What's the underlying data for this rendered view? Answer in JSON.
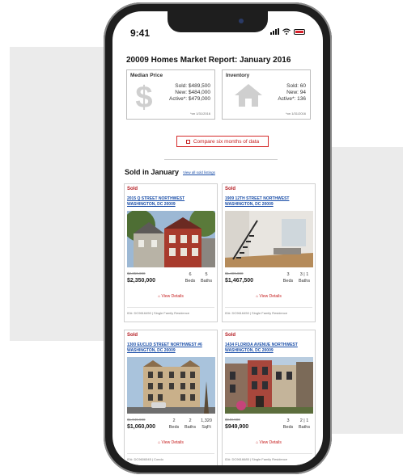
{
  "status_bar": {
    "time": "9:41"
  },
  "report": {
    "title": "20009 Homes Market Report: January 2016"
  },
  "median_price": {
    "heading": "Median Price",
    "sold": "Sold: $489,500",
    "new": "New: $484,000",
    "active": "Active*: $479,000",
    "note": "*on 1/31/2016",
    "icon": "dollar-icon"
  },
  "inventory": {
    "heading": "Inventory",
    "sold": "Sold: 60",
    "new": "New: 94",
    "active": "Active*: 136",
    "note": "*on 1/31/2016",
    "icon": "house-icon"
  },
  "compare_label": "Compare six months of data",
  "sold_section": {
    "heading": "Sold in January",
    "view_all": "View all sold listings"
  },
  "listings": [
    {
      "status": "Sold",
      "address_1": "2015 Q STREET NORTHWEST",
      "address_2": "WASHINGTON, DC 20009",
      "old_price": "$2,350,000",
      "price": "$2,350,000",
      "beds": "6",
      "baths": "5",
      "sqft": "",
      "view_label": "View Details",
      "footer": "ID#: DC9616450 | Single Family Residence"
    },
    {
      "status": "Sold",
      "address_1": "1909 12TH STREET NORTHWEST",
      "address_2": "WASHINGTON, DC 20009",
      "old_price": "$1,499,000",
      "price": "$1,467,500",
      "beds": "3",
      "baths": "3 | 1",
      "sqft": "",
      "view_label": "View Details",
      "footer": "ID#: DC9616450 | Single Family Residence"
    },
    {
      "status": "Sold",
      "address_1": "1300 EUCLID STREET NORTHWEST #6",
      "address_2": "WASHINGTON, DC 20009",
      "old_price": "$1,049,900",
      "price": "$1,060,000",
      "beds": "2",
      "baths": "2",
      "sqft": "1,320",
      "view_label": "View Details",
      "footer": "ID#: DC9606545 | Condo"
    },
    {
      "status": "Sold",
      "address_1": "1434 FLORIDA AVENUE NORTHWEST",
      "address_2": "WASHINGTON, DC 20009",
      "old_price": "$949,900",
      "price": "$949,900",
      "beds": "3",
      "baths": "2 | 1",
      "sqft": "",
      "view_label": "View Details",
      "footer": "ID#: DC9616685 | Single Family Residence"
    }
  ],
  "labels": {
    "beds": "Beds",
    "baths": "Baths",
    "sqft": "SqFt"
  },
  "colors": {
    "accent_red": "#c62020",
    "link_blue": "#1a4ea8",
    "sold_red": "#b3191f"
  }
}
